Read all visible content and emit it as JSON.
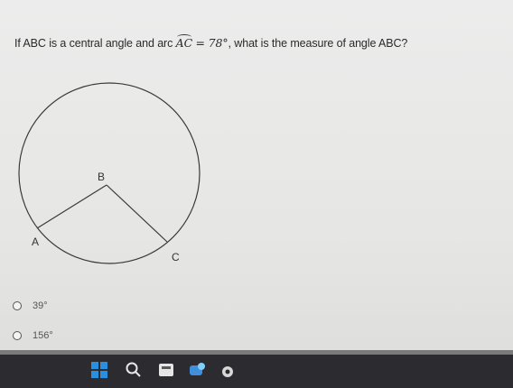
{
  "question": {
    "prefix": "If ABC is a central angle and arc",
    "arc_name": "AC",
    "arc_value": "= 78°",
    "suffix": ", what is the measure of angle ABC?"
  },
  "figure": {
    "point_b": "B",
    "point_a": "A",
    "point_c": "C"
  },
  "choices": [
    {
      "label": "39°"
    },
    {
      "label": "156°"
    }
  ],
  "taskbar": {
    "icons": [
      "windows-start-icon",
      "search-icon",
      "widgets-icon",
      "chat-icon",
      "browser-icon"
    ],
    "colors": {
      "windows_blue": "#2b8fe0",
      "background": "#2b2b30"
    }
  }
}
